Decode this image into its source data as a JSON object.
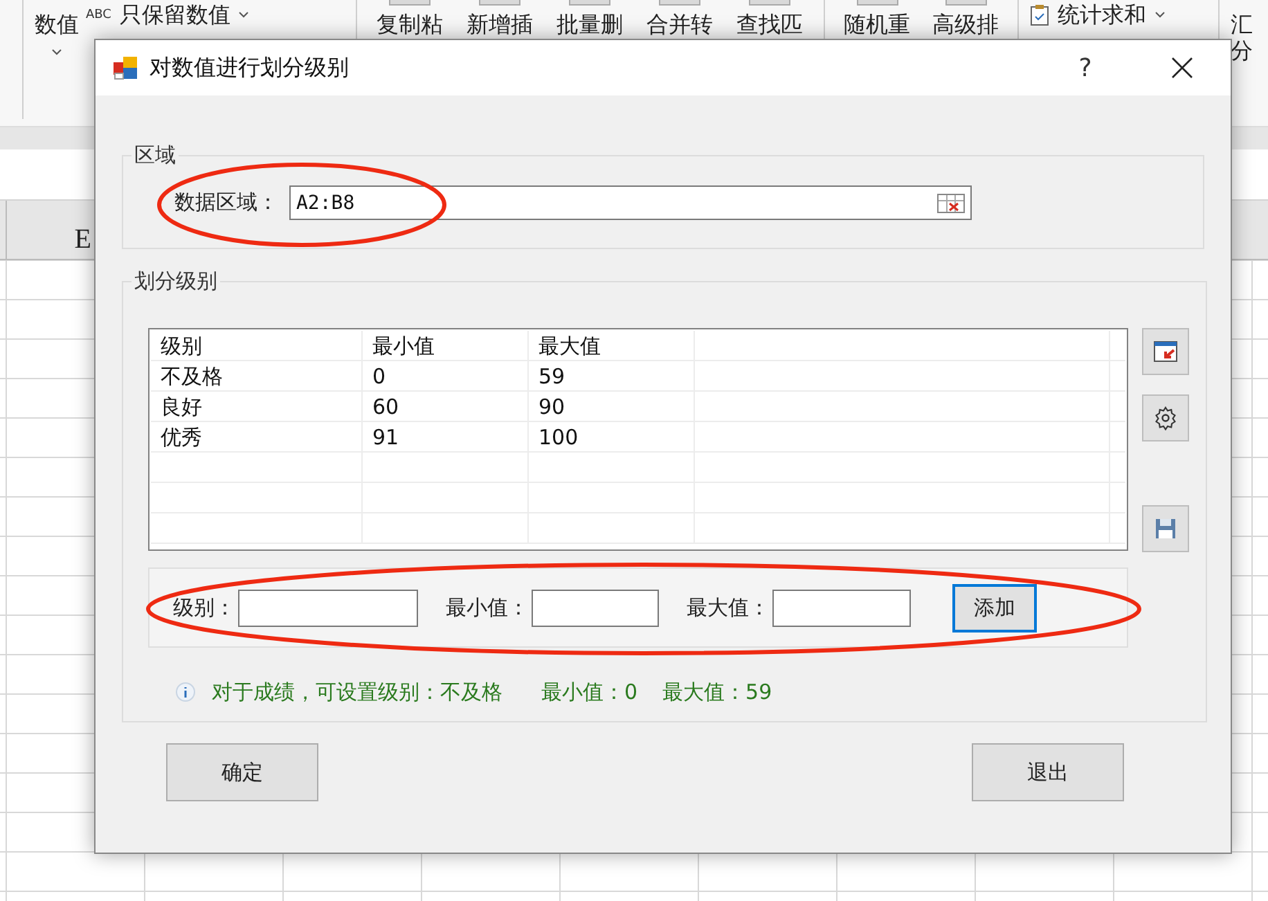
{
  "background": {
    "ribbon_groups": [
      {
        "items": [
          {
            "kind": "stacked",
            "label": "数值"
          },
          {
            "kind": "small",
            "prefix": "ABC",
            "label": "只保留数值"
          }
        ]
      },
      {
        "items": [
          {
            "kind": "large",
            "label": "复制粘"
          },
          {
            "kind": "large",
            "label": "新增插"
          },
          {
            "kind": "large",
            "label": "批量删"
          },
          {
            "kind": "large",
            "label": "合并转"
          },
          {
            "kind": "large",
            "label": "查找匹"
          }
        ]
      },
      {
        "items": [
          {
            "kind": "large",
            "label": "随机重"
          },
          {
            "kind": "large",
            "label": "高级排"
          }
        ]
      },
      {
        "items": [
          {
            "kind": "small",
            "label": "统计求和"
          }
        ]
      },
      {
        "items": [
          {
            "kind": "stacked",
            "label": "汇",
            "sub": "分"
          }
        ]
      }
    ],
    "column_header": "E"
  },
  "window": {
    "title": "对数值进行划分级别",
    "help": "?"
  },
  "region_group": {
    "legend": "区域",
    "label": "数据区域：",
    "value": "A2:B8"
  },
  "levels_group": {
    "legend": "划分级别",
    "columns": [
      "级别",
      "最小值",
      "最大值"
    ],
    "rows": [
      [
        "不及格",
        "0",
        "59"
      ],
      [
        "良好",
        "60",
        "90"
      ],
      [
        "优秀",
        "91",
        "100"
      ]
    ]
  },
  "entry": {
    "fields": [
      {
        "label": "级别："
      },
      {
        "label": "最小值："
      },
      {
        "label": "最大值："
      }
    ],
    "add_button": {
      "label": "添加",
      "focused": true
    }
  },
  "hint": [
    "对于成绩，可设置级别：不及格",
    "最小值：0",
    "最大值：59"
  ],
  "buttons": [
    "确定",
    "退出"
  ]
}
